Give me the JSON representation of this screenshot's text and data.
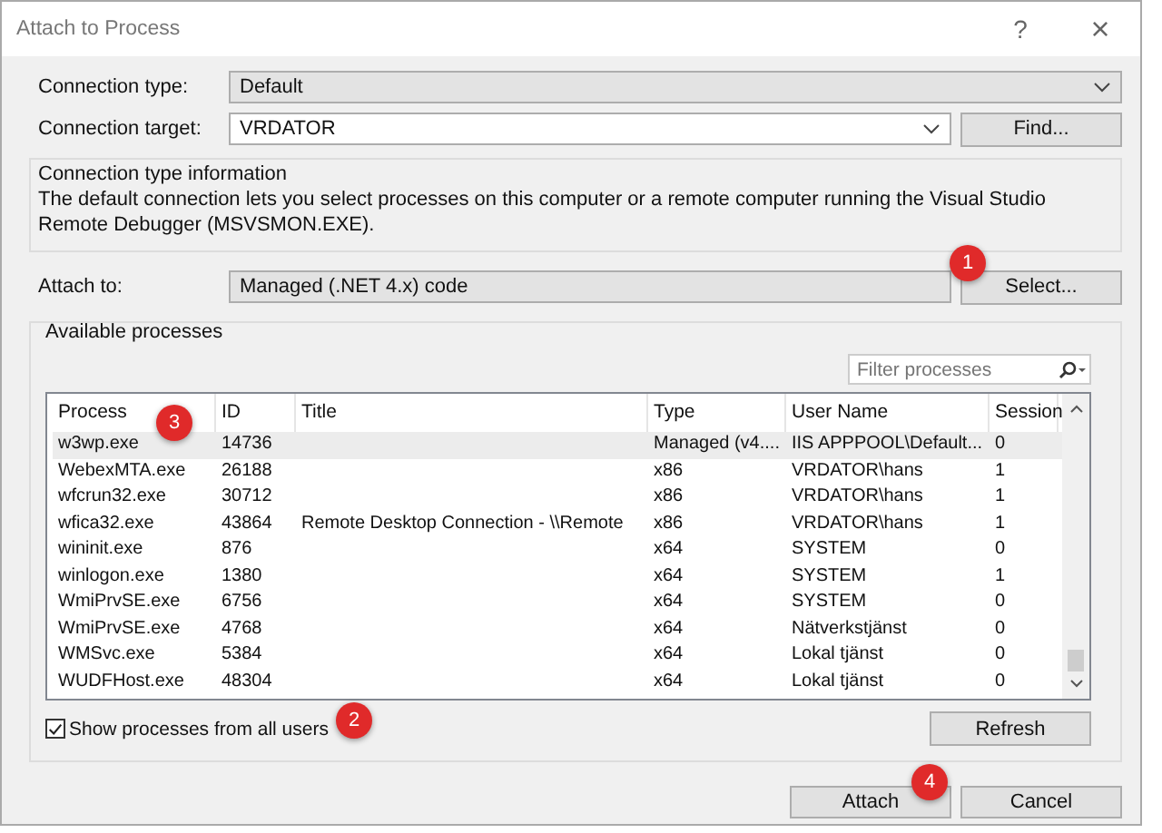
{
  "window": {
    "title": "Attach to Process",
    "help": "?",
    "close": "×"
  },
  "connection_type": {
    "label": "Connection type:",
    "value": "Default"
  },
  "connection_target": {
    "label": "Connection target:",
    "value": "VRDATOR",
    "button": "Find..."
  },
  "info": {
    "legend": "Connection type information",
    "text": "The default connection lets you select processes on this computer or a remote computer running the Visual Studio Remote Debugger (MSVSMON.EXE)."
  },
  "attach_to": {
    "label": "Attach to:",
    "value": "Managed (.NET 4.x) code",
    "button": "Select..."
  },
  "available": {
    "legend": "Available processes",
    "filter": {
      "placeholder": "Filter processes"
    },
    "columns": [
      "Process",
      "ID",
      "Title",
      "Type",
      "User Name",
      "Session"
    ],
    "rows": [
      {
        "cells": [
          "w3wp.exe",
          "14736",
          "",
          "Managed (v4....",
          "IIS APPPOOL\\Default...",
          "0"
        ],
        "selected": true
      },
      {
        "cells": [
          "WebexMTA.exe",
          "26188",
          "",
          "x86",
          "VRDATOR\\hans",
          "1"
        ],
        "selected": false
      },
      {
        "cells": [
          "wfcrun32.exe",
          "30712",
          "",
          "x86",
          "VRDATOR\\hans",
          "1"
        ],
        "selected": false
      },
      {
        "cells": [
          "wfica32.exe",
          "43864",
          "Remote Desktop Connection - \\\\Remote",
          "x86",
          "VRDATOR\\hans",
          "1"
        ],
        "selected": false
      },
      {
        "cells": [
          "wininit.exe",
          "876",
          "",
          "x64",
          "SYSTEM",
          "0"
        ],
        "selected": false
      },
      {
        "cells": [
          "winlogon.exe",
          "1380",
          "",
          "x64",
          "SYSTEM",
          "1"
        ],
        "selected": false
      },
      {
        "cells": [
          "WmiPrvSE.exe",
          "6756",
          "",
          "x64",
          "SYSTEM",
          "0"
        ],
        "selected": false
      },
      {
        "cells": [
          "WmiPrvSE.exe",
          "4768",
          "",
          "x64",
          "Nätverkstjänst",
          "0"
        ],
        "selected": false
      },
      {
        "cells": [
          "WMSvc.exe",
          "5384",
          "",
          "x64",
          "Lokal tjänst",
          "0"
        ],
        "selected": false
      },
      {
        "cells": [
          "WUDFHost.exe",
          "48304",
          "",
          "x64",
          "Lokal tjänst",
          "0"
        ],
        "selected": false
      }
    ],
    "show_all_users": {
      "label": "Show processes from all users",
      "checked": true
    },
    "refresh": "Refresh"
  },
  "buttons": [
    "Attach",
    "Cancel"
  ],
  "markers": [
    "1",
    "2",
    "3",
    "4"
  ]
}
